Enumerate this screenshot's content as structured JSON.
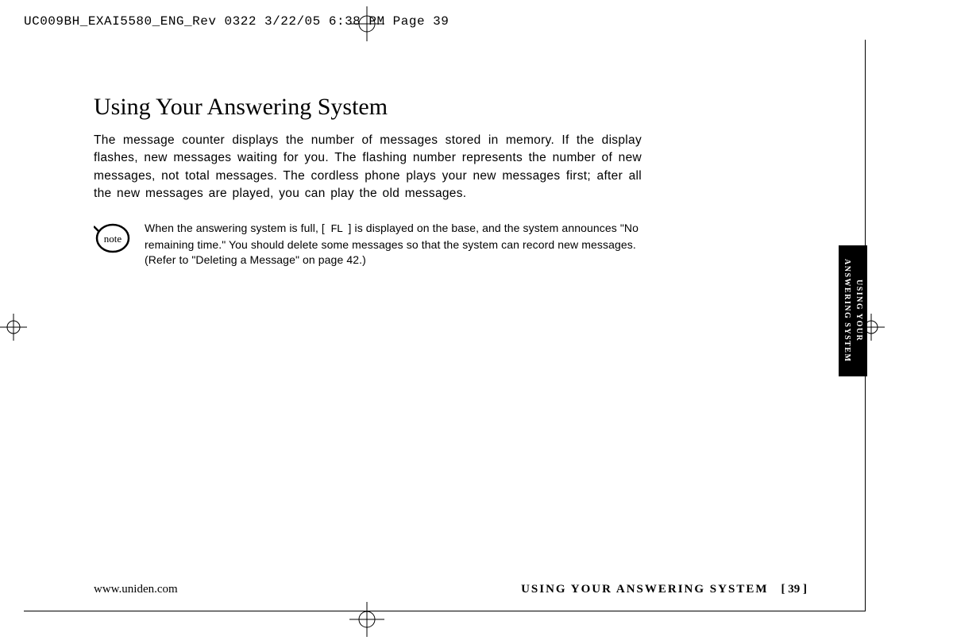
{
  "header_stamp": "UC009BH_EXAI5580_ENG_Rev 0322  3/22/05  6:38 PM  Page 39",
  "title": "Using Your Answering System",
  "intro_paragraph": "The message counter displays the number of messages stored in memory. If the display flashes, new messages waiting for you. The flashing number represents the number of new messages, not total messages. The cordless phone plays your new messages first; after all the new messages are played, you can play the old messages.",
  "note_icon_label": "note",
  "note_line1_a": "When the answering system is full, [",
  "note_fl": " FL ",
  "note_line1_b": "] is displayed on the base, and the system announces \"No",
  "note_line2": "remaining time.\" You should delete some messages so that the system can record new messages.",
  "note_line3": "(Refer to \"Deleting a Message\" on page 42.)",
  "side_tab_line1": "USING YOUR",
  "side_tab_line2": "ANSWERING SYSTEM",
  "footer": {
    "url": "www.uniden.com",
    "section": "USING YOUR ANSWERING SYSTEM",
    "page": "[ 39 ]"
  }
}
